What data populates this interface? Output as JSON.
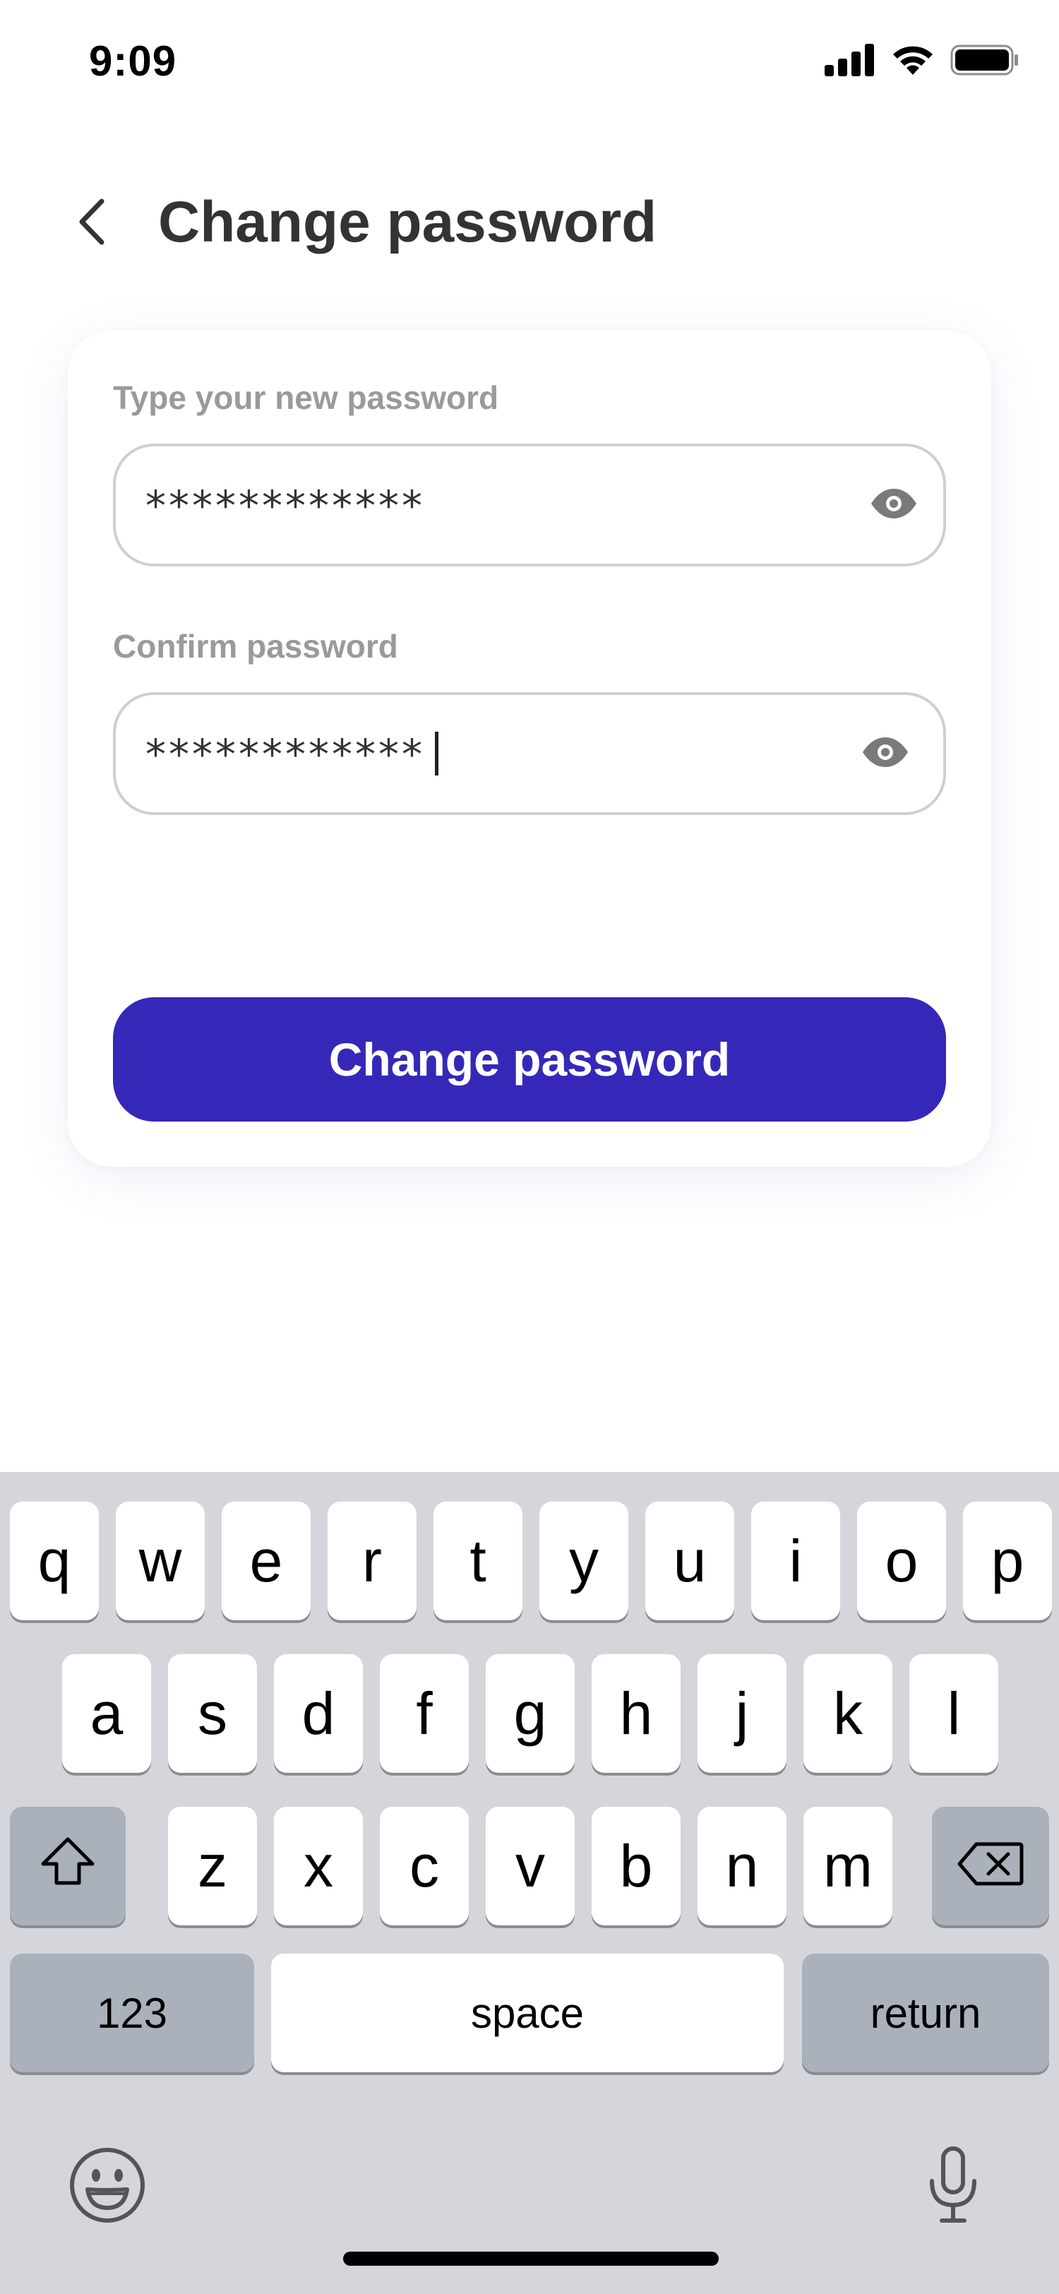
{
  "status_bar": {
    "time": "9:09"
  },
  "header": {
    "title": "Change password"
  },
  "form": {
    "new_password": {
      "label": "Type your new password",
      "value": "************"
    },
    "confirm_password": {
      "label": "Confirm password",
      "value": "************"
    },
    "submit_label": "Change password"
  },
  "keyboard": {
    "row1": [
      "q",
      "w",
      "e",
      "r",
      "t",
      "y",
      "u",
      "i",
      "o",
      "p"
    ],
    "row2": [
      "a",
      "s",
      "d",
      "f",
      "g",
      "h",
      "j",
      "k",
      "l"
    ],
    "row3": [
      "z",
      "x",
      "c",
      "v",
      "b",
      "n",
      "m"
    ],
    "numbers_label": "123",
    "space_label": "space",
    "return_label": "return"
  },
  "colors": {
    "accent": "#3528b8",
    "keyboard_bg": "#d4d6db",
    "dark_key": "#abb1ba",
    "label_gray": "#9a9a9a"
  },
  "icons": {
    "back": "chevron-left-icon",
    "eye": "eye-icon",
    "shift": "shift-icon",
    "delete": "backspace-icon",
    "emoji": "emoji-icon",
    "mic": "microphone-icon"
  }
}
